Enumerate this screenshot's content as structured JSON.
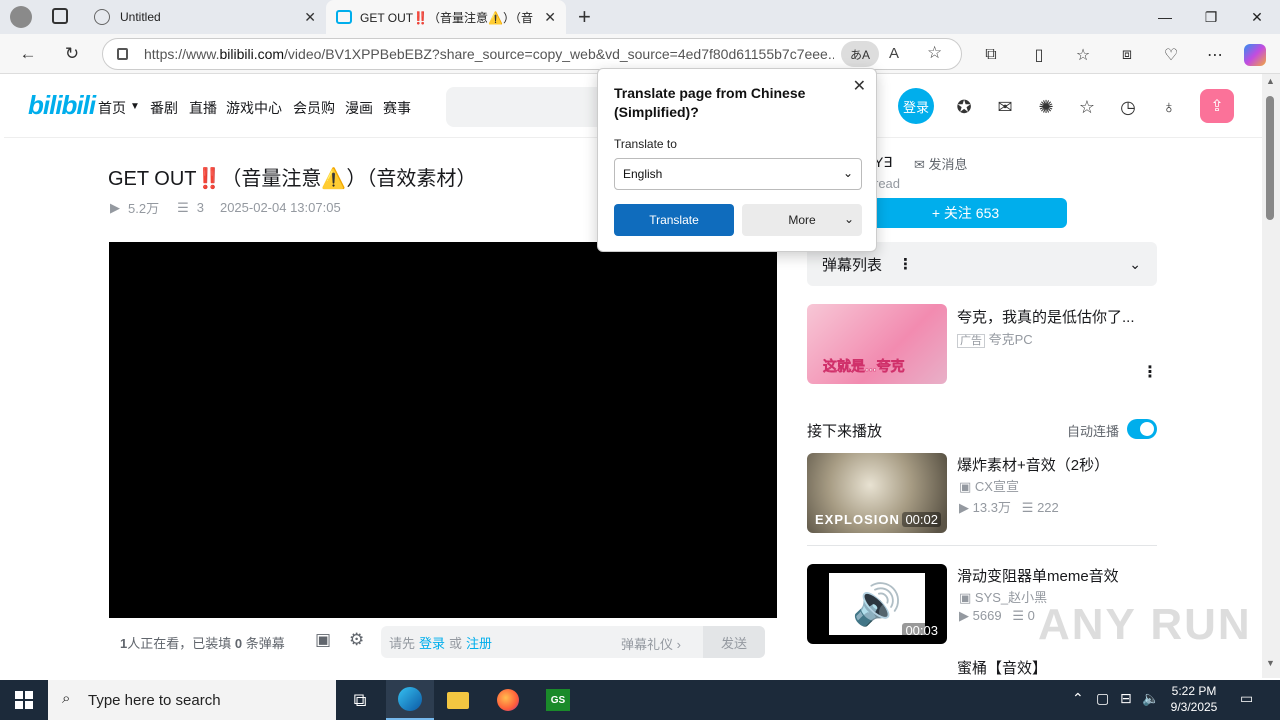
{
  "browser": {
    "tabs": [
      {
        "title": "Untitled",
        "icon": "globe-icon"
      },
      {
        "title": "GET OUT‼️（音量注意⚠️）（音",
        "icon": "bilibili-icon"
      }
    ],
    "url_prefix": "https://www.",
    "url_domain": "bilibili.com",
    "url_rest": "/video/BV1XPPBebEBZ?share_source=copy_web&vd_source=4ed7f80d61155b7c7eee...",
    "translate_badge": "あA"
  },
  "site": {
    "logo": "bilibili",
    "nav": [
      "首页",
      "番剧",
      "直播",
      "游戏中心",
      "会员购",
      "漫画",
      "赛事"
    ],
    "login": "登录"
  },
  "video": {
    "title": "GET OUT‼️（音量注意⚠️）（音效素材）",
    "views": "5.2万",
    "danmaku_count": "3",
    "date": "2025-02-04 13:07:05"
  },
  "danmaku_bar": {
    "watching_count": "1",
    "watching_mid": "人正在看，已装填 ",
    "danmaku_loaded": "0",
    "watching_suffix": " 条弹幕",
    "prompt": "请先",
    "login": "登录",
    "or": "或",
    "register": "注册",
    "etiquette": "弹幕礼仪",
    "send": "发送"
  },
  "uploader": {
    "name": "Y∃",
    "send_message": "发消息",
    "desc": "read",
    "follow": "+ 关注 653"
  },
  "sidebar": {
    "danmaku_list": "弹幕列表",
    "ad": {
      "title": "夸克，我真的是低估你了...",
      "tag": "广告",
      "source": "夸克PC",
      "thumb_text": "这就是...夸克"
    },
    "next_label": "接下来播放",
    "autoplay_label": "自动连播",
    "videos": [
      {
        "title": "爆炸素材+音效（2秒）",
        "author": "CX宣宣",
        "views": "13.3万",
        "danmaku": "222",
        "duration": "00:02",
        "thumb_text": "EXPLOSION"
      },
      {
        "title": "滑动变阻器单meme音效",
        "author": "SYS_赵小黑",
        "views": "5669",
        "danmaku": "0",
        "duration": "00:03"
      },
      {
        "title": "蜜桶【音效】"
      }
    ]
  },
  "translate_popup": {
    "title": "Translate page from Chinese (Simplified)?",
    "translate_to": "Translate to",
    "language": "English",
    "translate_btn": "Translate",
    "more_btn": "More"
  },
  "taskbar": {
    "search_placeholder": "Type here to search",
    "time": "5:22 PM",
    "date": "9/3/2025"
  },
  "watermark": "ANY RUN"
}
